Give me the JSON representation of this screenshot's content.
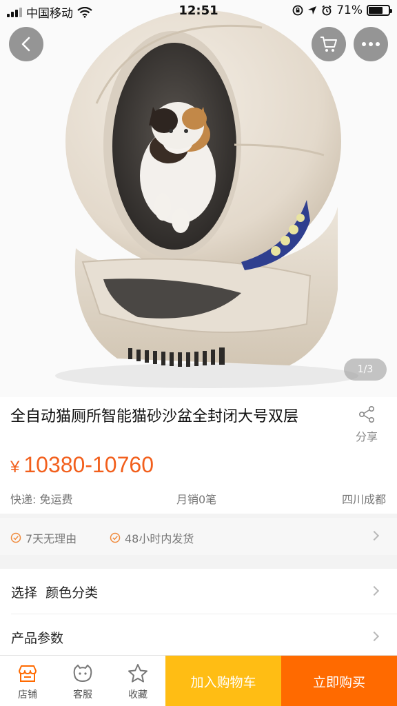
{
  "status_bar": {
    "carrier": "中国移动",
    "time": "12:51",
    "battery_percent": "71%",
    "battery_level": 0.71,
    "icons": [
      "signal-icon",
      "wifi-icon",
      "screen-lock-icon",
      "location-icon",
      "alarm-icon",
      "battery-icon"
    ]
  },
  "hero": {
    "image_subject": "white-litter-box-with-cat",
    "pager": "1/3",
    "icons": [
      "back-icon",
      "cart-icon",
      "more-icon"
    ]
  },
  "product": {
    "title": "全自动猫厕所智能猫砂沙盆全封闭大号双层",
    "share_label": "分享",
    "price_symbol": "¥",
    "price_range": "10380-10760",
    "shipping": "快递: 免运费",
    "monthly_sales": "月销0笔",
    "location": "四川成都"
  },
  "services": {
    "items": [
      "7天无理由",
      "48小时内发货"
    ]
  },
  "options": {
    "select_label": "选择",
    "select_value": "颜色分类",
    "params_label": "产品参数"
  },
  "bottom_bar": {
    "tabs": [
      {
        "label": "店铺",
        "icon": "store-icon"
      },
      {
        "label": "客服",
        "icon": "customer-service-icon"
      },
      {
        "label": "收藏",
        "icon": "star-icon"
      }
    ],
    "add_to_cart": "加入购物车",
    "buy_now": "立即购买"
  },
  "colors": {
    "price": "#f25f1c",
    "add_to_cart_bg": "#ffbd14",
    "buy_now_bg": "#ff6a00",
    "store_icon": "#ff6a00"
  }
}
